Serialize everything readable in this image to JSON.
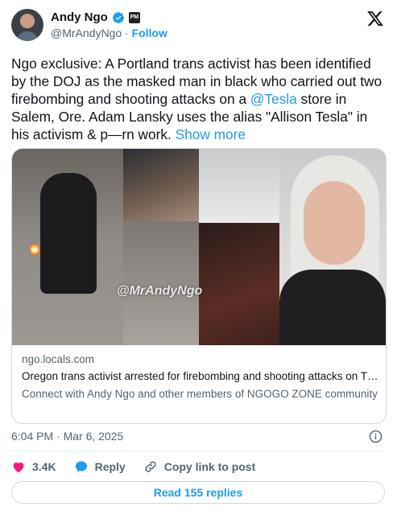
{
  "author": {
    "name": "Andy Ngo",
    "handle": "@MrAndyNgo",
    "separator": "·",
    "follow_label": "Follow",
    "verified_color": "#1d9bf0",
    "affiliate_badge_text": "PM"
  },
  "tweet": {
    "text_before": "Ngo exclusive: A Portland trans activist has been identified by the DOJ as the masked man in black who carried out two firebombing and shooting attacks on a ",
    "mention": "@Tesla",
    "text_after": " store in Salem, Ore. Adam Lansky uses the alias \"Allison Tesla\" in his activism & p—rn work. ",
    "show_more": "Show more"
  },
  "media": {
    "watermark": "@MrAndyNgo"
  },
  "link_card": {
    "domain": "ngo.locals.com",
    "title": "Oregon trans activist arrested for firebombing and shooting attacks on T…",
    "description": "Connect with Andy Ngo and other members of NGOGO ZONE community"
  },
  "timestamp": "6:04 PM · Mar 6, 2025",
  "actions": {
    "likes": "3.4K",
    "reply": "Reply",
    "copy_link": "Copy link to post",
    "like_color": "#f91880",
    "reply_color": "#1d9bf0"
  },
  "read_replies": "Read 155 replies",
  "icons": [
    "x-logo-icon",
    "verified-icon",
    "info-icon",
    "heart-icon",
    "reply-icon",
    "link-icon"
  ]
}
